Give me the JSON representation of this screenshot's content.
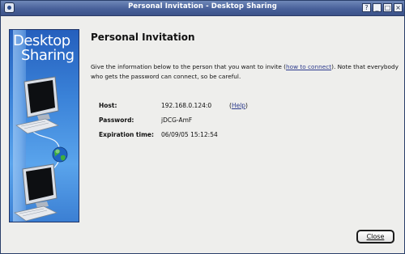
{
  "window": {
    "title": "Personal Invitation - Desktop Sharing",
    "controls": [
      "?",
      "_",
      "□",
      "×"
    ]
  },
  "sidebar": {
    "title_line1": "Desktop",
    "title_line2": "Sharing"
  },
  "main": {
    "heading": "Personal Invitation",
    "description_before": "Give the information below to the person that you want to invite (",
    "description_link": "how to connect",
    "description_after": ").  Note that everybody who gets the password can connect, so be careful.",
    "fields": {
      "host": {
        "label": "Host:",
        "value": "192.168.0.124:0",
        "help_open": "(",
        "help_link": "Help",
        "help_close": ")"
      },
      "password": {
        "label": "Password:",
        "value": "jDCG-AmF"
      },
      "expiration": {
        "label": "Expiration time:",
        "value": "06/09/05 15:12:54"
      }
    }
  },
  "footer": {
    "close_label": "Close"
  },
  "colors": {
    "titlebar": "#48619a",
    "sidebar_blue": "#3a82d8",
    "link": "#2c3a8c"
  }
}
